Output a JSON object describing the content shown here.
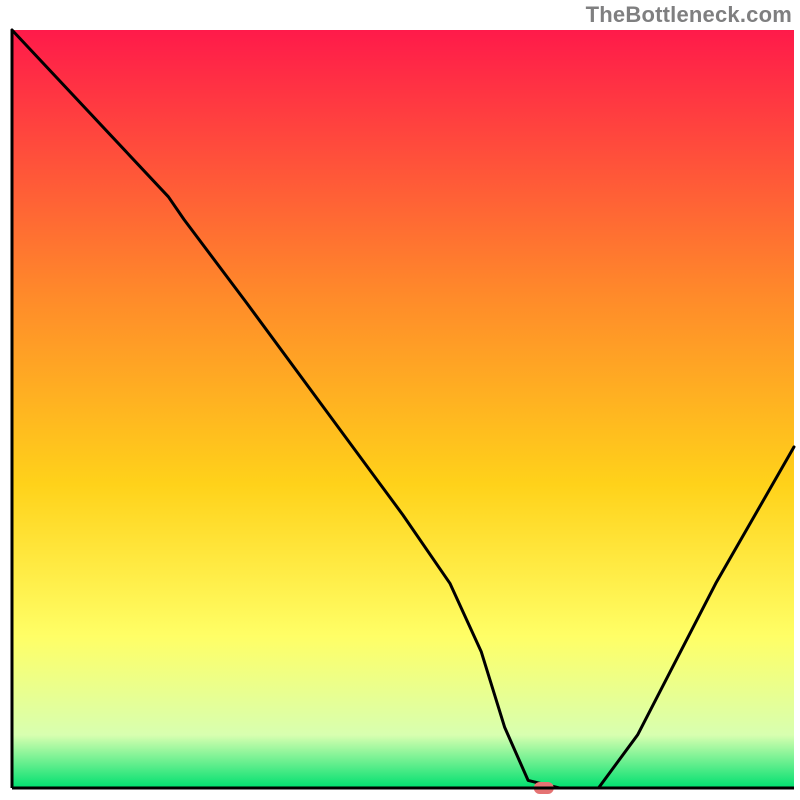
{
  "watermark": "TheBottleneck.com",
  "colors": {
    "gradient_top": "#ff1a4a",
    "gradient_mid1": "#ff8a2a",
    "gradient_mid2": "#ffd21a",
    "gradient_mid3": "#ffff66",
    "gradient_mid4": "#d8ffb0",
    "gradient_bottom": "#00e070",
    "curve": "#000000",
    "axis": "#000000",
    "marker": "#e57373"
  },
  "chart_data": {
    "type": "line",
    "title": "",
    "xlabel": "",
    "ylabel": "",
    "xlim": [
      0,
      100
    ],
    "ylim": [
      0,
      100
    ],
    "legend": false,
    "grid": false,
    "x": [
      0,
      10,
      20,
      22,
      30,
      40,
      50,
      56,
      60,
      63,
      66,
      70,
      75,
      80,
      85,
      90,
      95,
      100
    ],
    "series": [
      {
        "name": "bottleneck_curve",
        "values": [
          100,
          89,
          78,
          75,
          64,
          50,
          36,
          27,
          18,
          8,
          1,
          0,
          0,
          7,
          17,
          27,
          36,
          45
        ]
      }
    ],
    "marker": {
      "x": 68,
      "y": 0
    },
    "annotations": []
  }
}
